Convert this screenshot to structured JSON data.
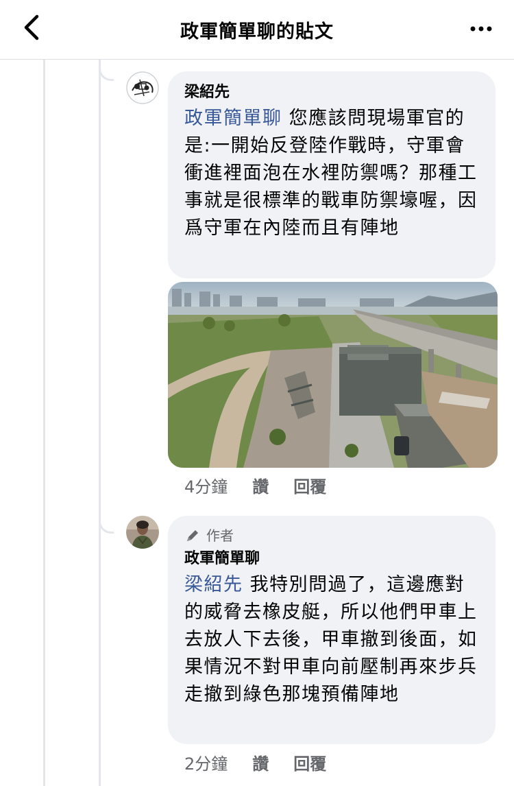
{
  "header": {
    "title": "政軍簡單聊的貼文",
    "back_icon": "chevron-left-icon",
    "more_icon": "more-horizontal-icon"
  },
  "comments": [
    {
      "author": "梁紹先",
      "mention": "政軍簡單聊",
      "text": " 您應該問現場軍官的是:一開始反登陸作戰時，守軍會衝進裡面泡在水裡防禦嗎？那種工事就是很標準的戰車防禦壕喔，因爲守軍在內陸而且有陣地",
      "attachment": "photo",
      "time": "4分鐘",
      "like_label": "讚",
      "reply_label": "回覆"
    },
    {
      "badge": "作者",
      "badge_icon": "pencil-icon",
      "author": "政軍簡單聊",
      "mention": "梁紹先",
      "text": " 我特別問過了，這邊應對的威脅去橡皮艇，所以他們甲車上去放人下去後，甲車撤到後面，如果情況不對甲車向前壓制再來步兵走撤到綠色那塊預備陣地",
      "time": "2分鐘",
      "like_label": "讚",
      "reply_label": "回覆"
    }
  ],
  "colors": {
    "mention": "#385898",
    "bubble": "#f0f2f5",
    "meta_text": "#65676b",
    "thread_line": "#e4e6eb"
  }
}
